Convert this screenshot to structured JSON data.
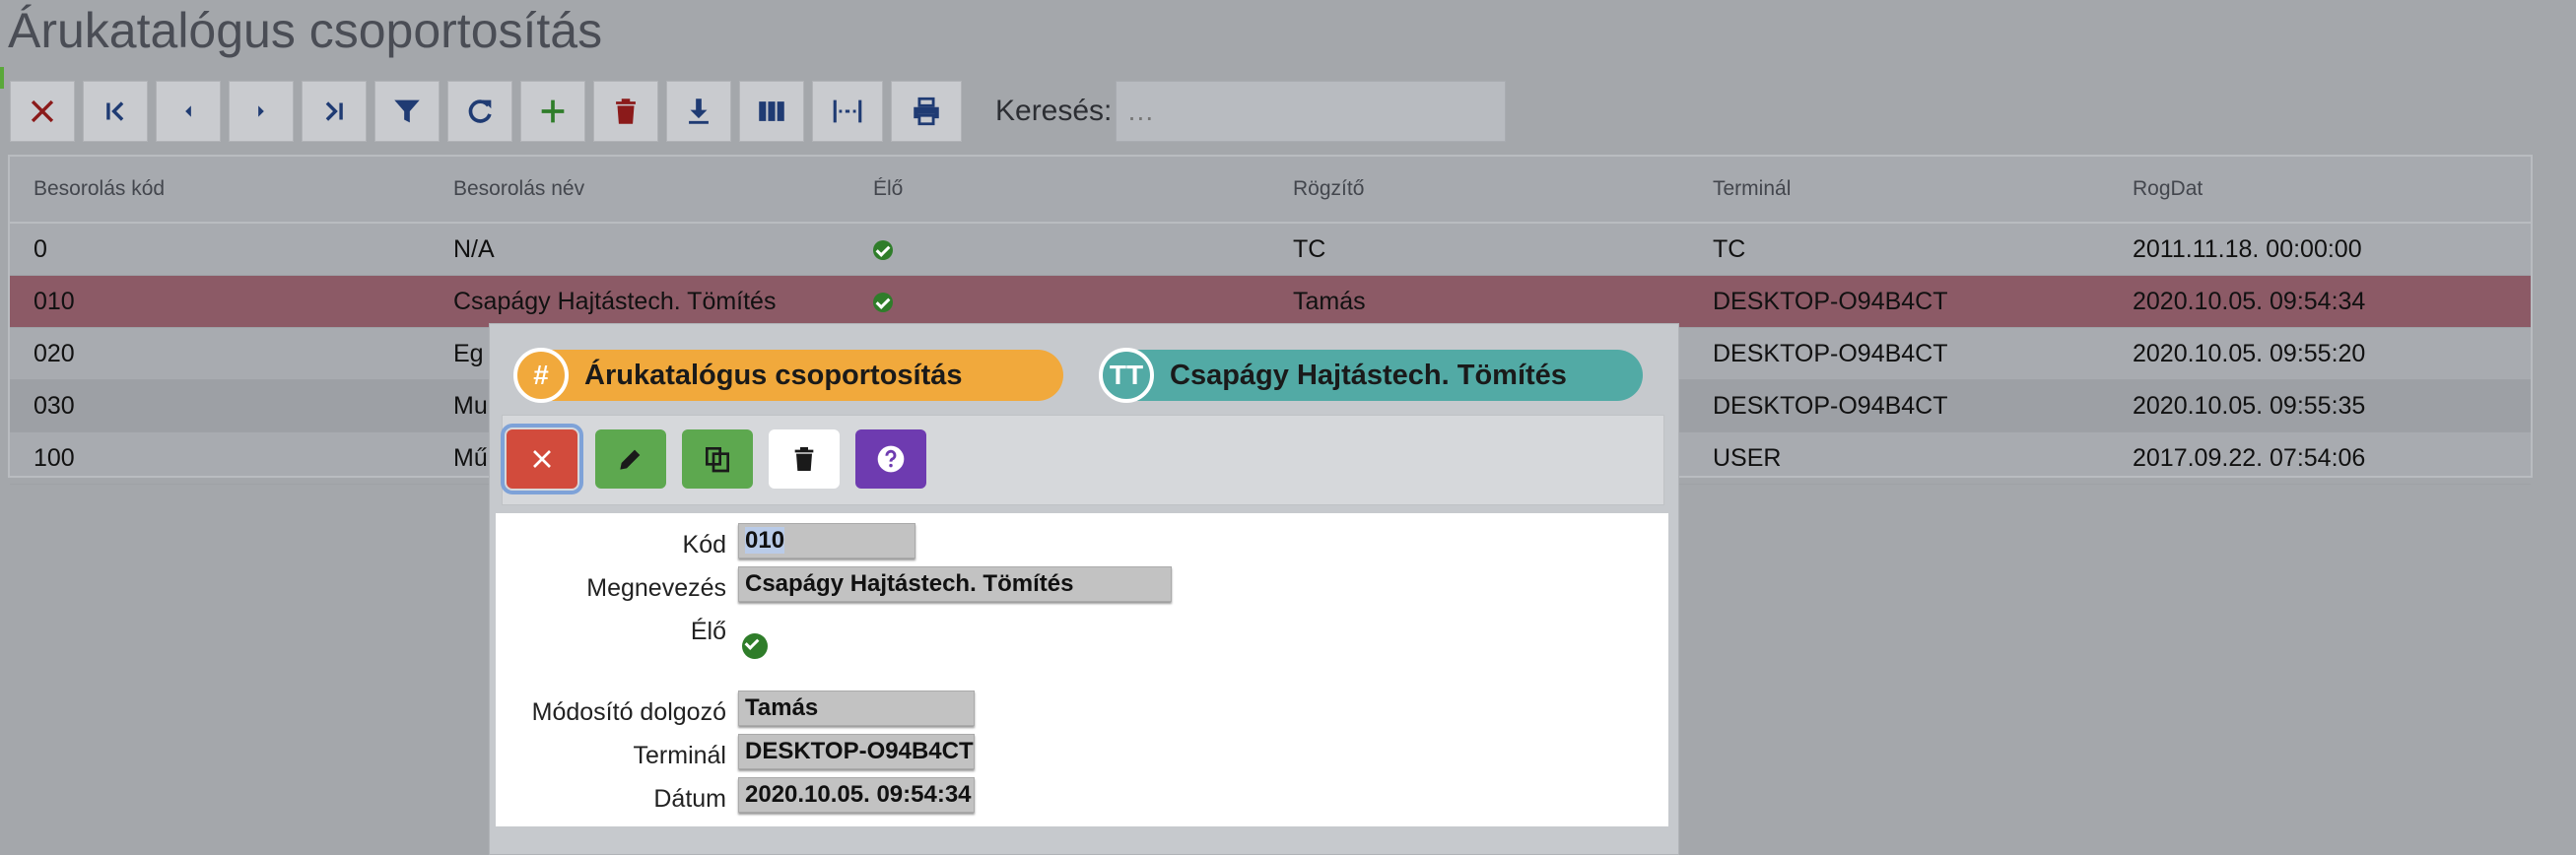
{
  "page": {
    "title": "Árukatalógus csoportosítás"
  },
  "toolbar": {
    "buttons": [
      {
        "name": "close",
        "icon": "close-icon"
      },
      {
        "name": "first",
        "icon": "first-record-icon"
      },
      {
        "name": "prev",
        "icon": "previous-icon"
      },
      {
        "name": "next",
        "icon": "next-icon"
      },
      {
        "name": "last",
        "icon": "last-record-icon"
      },
      {
        "name": "filter",
        "icon": "filter-icon"
      },
      {
        "name": "refresh",
        "icon": "refresh-icon"
      },
      {
        "name": "add",
        "icon": "add-icon"
      },
      {
        "name": "delete",
        "icon": "trash-icon"
      },
      {
        "name": "download",
        "icon": "download-icon"
      },
      {
        "name": "columns",
        "icon": "columns-icon"
      },
      {
        "name": "fit-columns",
        "icon": "fit-columns-icon"
      },
      {
        "name": "print",
        "icon": "print-icon"
      }
    ],
    "search_label": "Keresés:",
    "search_placeholder": "…"
  },
  "grid": {
    "columns": [
      "Besorolás kód",
      "Besorolás név",
      "Élő",
      "Rögzítő",
      "Terminál",
      "RogDat"
    ],
    "rows": [
      {
        "kod": "0",
        "nev": "N/A",
        "elo": true,
        "rogzito": "TC",
        "terminal": "TC",
        "rogdat": "2011.11.18. 00:00:00"
      },
      {
        "kod": "010",
        "nev": "Csapágy Hajtástech. Tömítés",
        "elo": true,
        "rogzito": "Tamás",
        "terminal": "DESKTOP-O94B4CT",
        "rogdat": "2020.10.05. 09:54:34"
      },
      {
        "kod": "020",
        "nev": "Eg",
        "elo": true,
        "rogzito": "",
        "terminal": "DESKTOP-O94B4CT",
        "rogdat": "2020.10.05. 09:55:20"
      },
      {
        "kod": "030",
        "nev": "Mu",
        "elo": true,
        "rogzito": "",
        "terminal": "DESKTOP-O94B4CT",
        "rogdat": "2020.10.05. 09:55:35"
      },
      {
        "kod": "100",
        "nev": "Mű",
        "elo": true,
        "rogzito": "",
        "terminal": "USER",
        "rogdat": "2017.09.22. 07:54:06"
      }
    ],
    "selected_index": 1
  },
  "modal": {
    "pill_left": {
      "icon": "hash-icon",
      "glyph": "#",
      "text": "Árukatalógus csoportosítás",
      "color": "#f1a93c"
    },
    "pill_right": {
      "icon": "text-size-icon",
      "glyph": "TT",
      "text": "Csapágy Hajtástech. Tömítés",
      "color": "#52aaa5"
    },
    "buttons": [
      {
        "name": "close",
        "icon": "close-icon",
        "color": "#d24b3c"
      },
      {
        "name": "edit",
        "icon": "pencil-icon",
        "color": "#5da84f"
      },
      {
        "name": "copy",
        "icon": "copy-icon",
        "color": "#5da84f"
      },
      {
        "name": "delete",
        "icon": "trash-icon",
        "color": "#ffffff"
      },
      {
        "name": "help",
        "icon": "help-icon",
        "color": "#6e3bb0"
      }
    ],
    "form": {
      "kod_label": "Kód",
      "kod_value": "010",
      "megnevezes_label": "Megnevezés",
      "megnevezes_value": "Csapágy Hajtástech. Tömítés",
      "elo_label": "Élő",
      "elo_value": true,
      "modosito_label": "Módosító dolgozó",
      "modosito_value": "Tamás",
      "terminal_label": "Terminál",
      "terminal_value": "DESKTOP-O94B4CT",
      "datum_label": "Dátum",
      "datum_value": "2020.10.05. 09:54:34"
    }
  }
}
